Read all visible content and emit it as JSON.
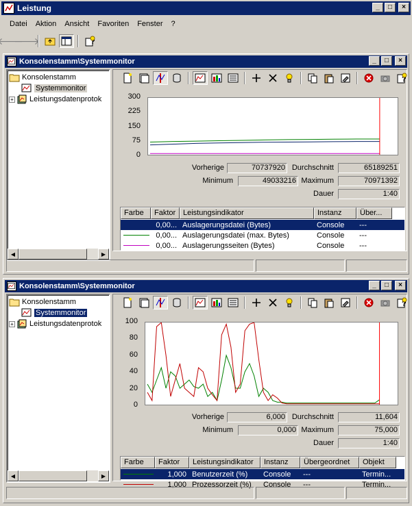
{
  "app": {
    "title": "Leistung",
    "menu": [
      "Datei",
      "Aktion",
      "Ansicht",
      "Favoriten",
      "Fenster",
      "?"
    ]
  },
  "windows": [
    {
      "title": "Konsolenstamm\\Systemmonitor",
      "tree": {
        "root": "Konsolenstamm",
        "items": [
          "Systemmonitor",
          "Leistungsdatenprotok"
        ]
      },
      "y_ticks": [
        "300",
        "225",
        "150",
        "75",
        "0"
      ],
      "stats": {
        "vorherige_label": "Vorherige",
        "vorherige": "70737920",
        "durchschnitt_label": "Durchschnitt",
        "durchschnitt": "65189251",
        "minimum_label": "Minimum",
        "minimum": "49033216",
        "maximum_label": "Maximum",
        "maximum": "70971392",
        "dauer_label": "Dauer",
        "dauer": "1:40"
      },
      "columns": [
        "Farbe",
        "Faktor",
        "Leistungsindikator",
        "Instanz",
        "Über..."
      ],
      "rows": [
        {
          "color": "#0a246a",
          "faktor": "0,00...",
          "indikator": "Auslagerungsdatei (Bytes)",
          "instanz": "Console",
          "ueber": "---"
        },
        {
          "color": "#008000",
          "faktor": "0,00...",
          "indikator": "Auslagerungsdatei (max. Bytes)",
          "instanz": "Console",
          "ueber": "---"
        },
        {
          "color": "#c000c0",
          "faktor": "0,00...",
          "indikator": "Auslagerungsseiten (Bytes)",
          "instanz": "Console",
          "ueber": "---"
        }
      ]
    },
    {
      "title": "Konsolenstamm\\Systemmonitor",
      "tree": {
        "root": "Konsolenstamm",
        "items": [
          "Systemmonitor",
          "Leistungsdatenprotok"
        ]
      },
      "y_ticks": [
        "100",
        "80",
        "60",
        "40",
        "20",
        "0"
      ],
      "stats": {
        "vorherige_label": "Vorherige",
        "vorherige": "6,000",
        "durchschnitt_label": "Durchschnitt",
        "durchschnitt": "11,604",
        "minimum_label": "Minimum",
        "minimum": "0,000",
        "maximum_label": "Maximum",
        "maximum": "75,000",
        "dauer_label": "Dauer",
        "dauer": "1:40"
      },
      "columns": [
        "Farbe",
        "Faktor",
        "Leistungsindikator",
        "Instanz",
        "Übergeordnet",
        "Objekt"
      ],
      "rows": [
        {
          "color": "#008000",
          "faktor": "1,000",
          "indikator": "Benutzerzeit (%)",
          "instanz": "Console",
          "ueber": "---",
          "objekt": "Termin..."
        },
        {
          "color": "#c00000",
          "faktor": "1,000",
          "indikator": "Prozessorzeit (%)",
          "instanz": "Console",
          "ueber": "---",
          "objekt": "Termin..."
        }
      ]
    }
  ],
  "colors": {
    "title_bar": "#0a246a",
    "face": "#d4d0c8",
    "time_bar": "#ff0000"
  },
  "chart_data": [
    {
      "type": "line",
      "ylim": [
        0,
        300
      ],
      "x": [
        0,
        10,
        20,
        30,
        40,
        50,
        60,
        70,
        80,
        90,
        100
      ],
      "series": [
        {
          "values": [
            67,
            70,
            72,
            74,
            76,
            78,
            80,
            81,
            82,
            83,
            83
          ]
        },
        {
          "values": [
            52,
            56,
            60,
            62,
            64,
            66,
            67,
            68,
            69,
            70,
            70
          ]
        },
        {
          "values": [
            6,
            6,
            6,
            6,
            6,
            6,
            6,
            6,
            6,
            6,
            6
          ]
        }
      ]
    },
    {
      "type": "line",
      "ylim": [
        0,
        100
      ],
      "x": [
        0,
        2,
        4,
        6,
        8,
        10,
        12,
        14,
        16,
        18,
        20,
        22,
        24,
        26,
        28,
        30,
        32,
        34,
        36,
        38,
        40,
        42,
        44,
        46,
        48,
        50,
        52,
        54,
        56,
        58,
        60,
        62,
        64,
        66,
        68,
        70,
        72,
        74,
        76,
        78,
        80,
        82,
        84,
        86,
        88,
        90,
        92,
        94,
        96,
        98,
        100
      ],
      "series": [
        {
          "values": [
            25,
            15,
            30,
            45,
            20,
            40,
            35,
            20,
            25,
            30,
            22,
            20,
            25,
            10,
            15,
            5,
            30,
            60,
            45,
            20,
            20,
            40,
            50,
            35,
            10,
            20,
            15,
            5,
            3,
            3,
            2,
            2,
            2,
            2,
            2,
            2,
            2,
            2,
            2,
            2,
            2,
            2,
            2,
            2,
            2,
            2,
            2,
            2,
            2,
            2,
            6
          ]
        },
        {
          "values": [
            15,
            5,
            95,
            100,
            60,
            10,
            30,
            50,
            20,
            15,
            10,
            45,
            40,
            20,
            12,
            5,
            85,
            98,
            70,
            15,
            25,
            90,
            98,
            100,
            55,
            15,
            5,
            12,
            8,
            2,
            1,
            1,
            1,
            1,
            1,
            1,
            1,
            1,
            1,
            1,
            1,
            1,
            1,
            1,
            1,
            1,
            1,
            1,
            1,
            1,
            1
          ]
        }
      ]
    }
  ]
}
